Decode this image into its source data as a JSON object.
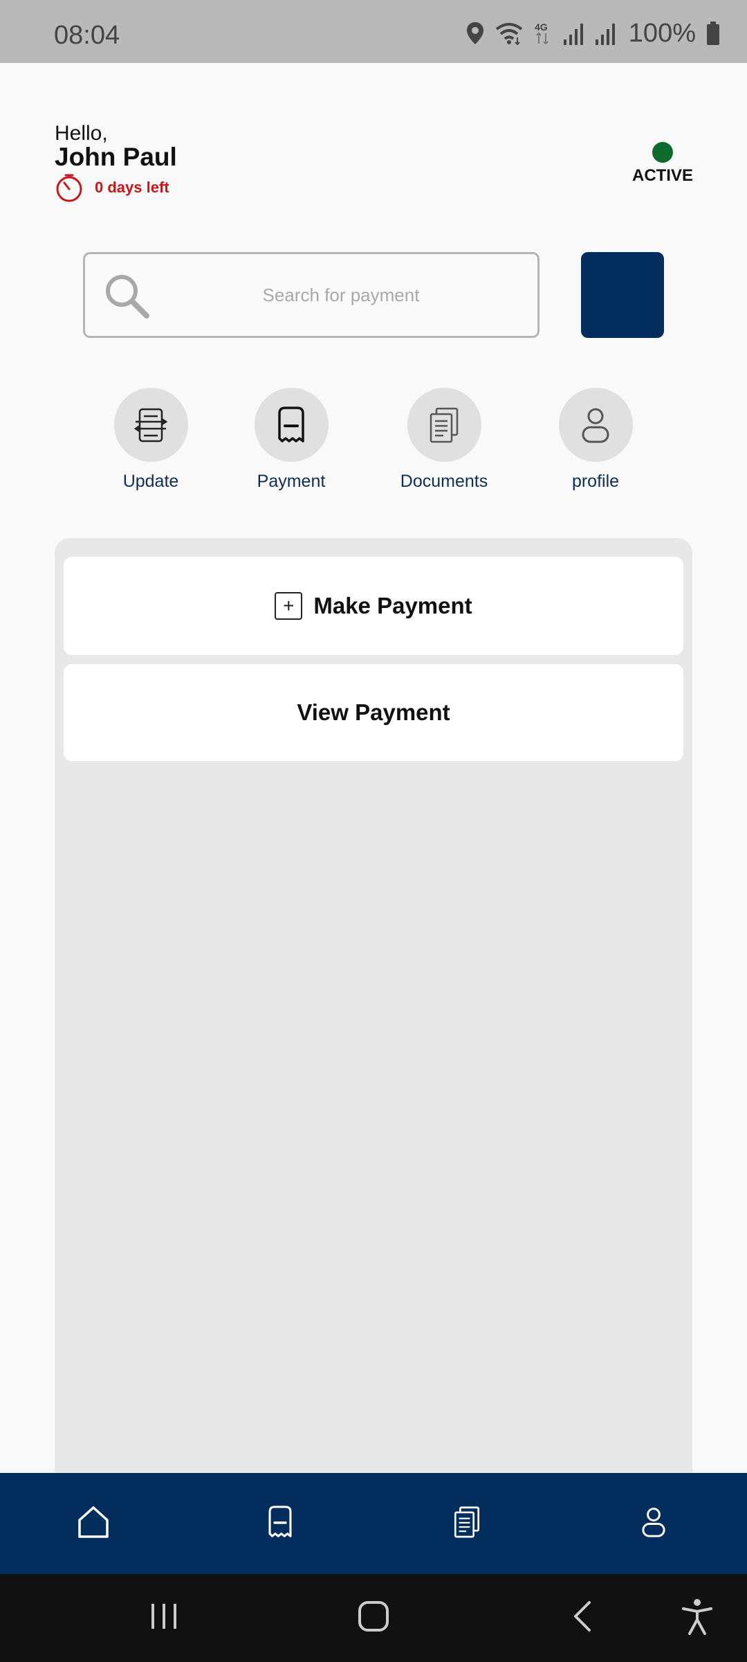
{
  "status_bar": {
    "time": "08:04",
    "battery": "100%",
    "network": "4G",
    "icons": [
      "location-icon",
      "wifi-icon",
      "network-4g-icon",
      "signal-icon",
      "signal-icon",
      "battery-icon"
    ]
  },
  "header": {
    "greeting": "Hello,",
    "user_name": "John Paul",
    "days_left": "0 days left",
    "status": "ACTIVE",
    "status_color": "#0f6b2d",
    "days_color": "#c8161c"
  },
  "search": {
    "placeholder": "Search for payment",
    "value": ""
  },
  "quick_actions": [
    {
      "label": "Update",
      "icon": "update-document-icon"
    },
    {
      "label": "Payment",
      "icon": "receipt-icon"
    },
    {
      "label": "Documents",
      "icon": "documents-icon"
    },
    {
      "label": "profile",
      "icon": "profile-icon"
    }
  ],
  "panel": {
    "make_payment": "Make Payment",
    "view_payment": "View Payment"
  },
  "bottom_nav": [
    {
      "icon": "home-icon"
    },
    {
      "icon": "receipt-icon"
    },
    {
      "icon": "documents-icon"
    },
    {
      "icon": "profile-icon"
    }
  ],
  "system_nav": [
    {
      "icon": "recent-apps-icon"
    },
    {
      "icon": "home-button-icon"
    },
    {
      "icon": "back-icon"
    },
    {
      "icon": "accessibility-icon"
    }
  ],
  "colors": {
    "brand_navy": "#022d5d",
    "label_navy": "#0e2e55",
    "status_bar": "#b9b9b9",
    "panel": "#e8e8e8"
  }
}
